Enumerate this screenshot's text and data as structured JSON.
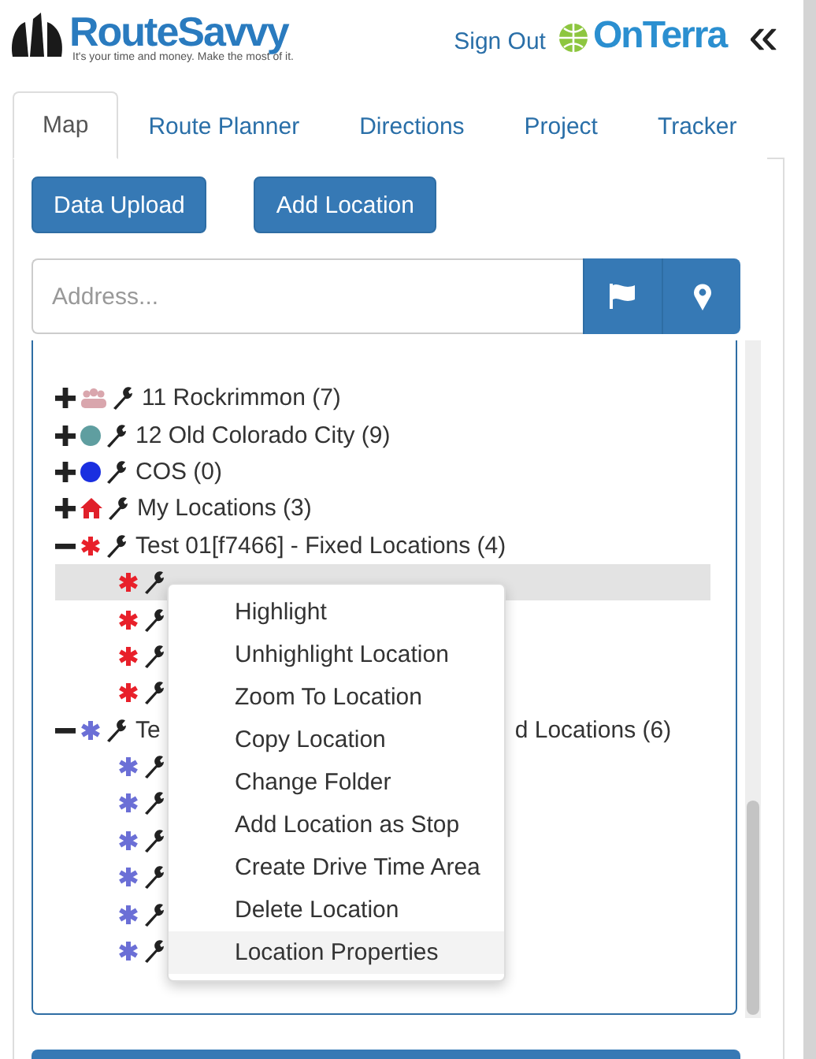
{
  "header": {
    "logo_text": "RouteSavvy",
    "logo_tagline": "It's your time and money. Make the most of it.",
    "sign_out": "Sign Out",
    "partner_logo": "OnTerra",
    "collapse": "«"
  },
  "tabs": [
    {
      "label": "Map",
      "selected": true
    },
    {
      "label": "Route Planner",
      "selected": false
    },
    {
      "label": "Directions",
      "selected": false
    },
    {
      "label": "Project",
      "selected": false
    },
    {
      "label": "Tracker",
      "selected": false
    }
  ],
  "buttons": [
    "Data Upload",
    "Add Location"
  ],
  "address": {
    "placeholder": "Address..."
  },
  "tree": [
    {
      "kind": "people",
      "label": "11 Rockrimmon (7)",
      "expanded": false,
      "color": "#d9a6ad"
    },
    {
      "kind": "dot",
      "label": "12 Old Colorado City (9)",
      "expanded": false,
      "color": "#5f9ea0"
    },
    {
      "kind": "dot",
      "label": "COS (0)",
      "expanded": false,
      "color": "#1a2fe0"
    },
    {
      "kind": "home",
      "label": "My Locations (3)",
      "expanded": false,
      "color": "#e0202a"
    },
    {
      "kind": "asterisk",
      "label": "Test 01[f7466] - Fixed Locations (4)",
      "expanded": true,
      "color": "#e8202a",
      "children": [
        {
          "selected": true
        },
        {
          "selected": false
        },
        {
          "selected": false
        },
        {
          "selected": false
        }
      ]
    },
    {
      "kind": "asterisk",
      "label_start": "Te",
      "label_end": "d Locations (6)",
      "expanded": true,
      "color": "#6b6fd6",
      "children": [
        {
          "selected": false
        },
        {
          "selected": false
        },
        {
          "selected": false
        },
        {
          "selected": false
        },
        {
          "selected": false
        },
        {
          "selected": false
        }
      ]
    }
  ],
  "context_menu": [
    {
      "label": "Highlight",
      "hovered": false
    },
    {
      "label": "Unhighlight Location",
      "hovered": false
    },
    {
      "label": "Zoom To Location",
      "hovered": false
    },
    {
      "label": "Copy Location",
      "hovered": false
    },
    {
      "label": "Change Folder",
      "hovered": false
    },
    {
      "label": "Add Location as Stop",
      "hovered": false
    },
    {
      "label": "Create Drive Time Area",
      "hovered": false
    },
    {
      "label": "Delete Location",
      "hovered": false
    },
    {
      "label": "Location Properties",
      "hovered": true
    }
  ]
}
